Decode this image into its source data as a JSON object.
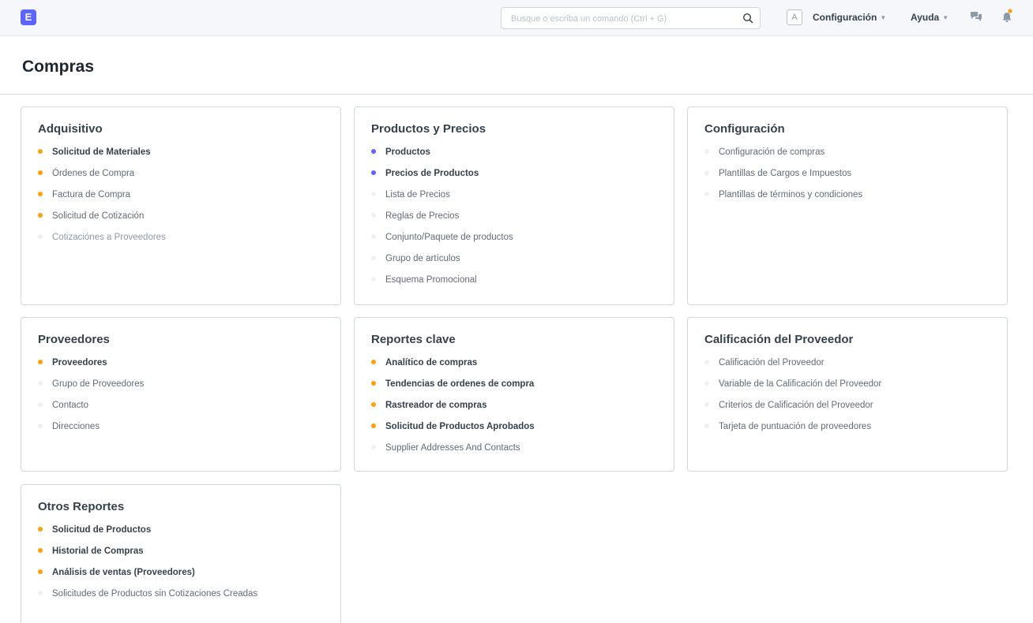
{
  "app": {
    "logo_letter": "E"
  },
  "navbar": {
    "search_placeholder": "Busque o escriba un comando (Ctrl + G)",
    "avatar_letter": "A",
    "settings_label": "Configuración",
    "help_label": "Ayuda",
    "accent_color": "#5e64ff",
    "notification_dot_color": "#ffa00a"
  },
  "page": {
    "title": "Compras"
  },
  "cards": {
    "adquisitivo": {
      "title": "Adquisitivo",
      "links": [
        {
          "label": "Solicitud de Materiales",
          "dot": "orange"
        },
        {
          "label": "Órdenes de Compra",
          "dot": "orange"
        },
        {
          "label": "Factura de Compra",
          "dot": "orange"
        },
        {
          "label": "Solicitud de Cotización",
          "dot": "orange"
        },
        {
          "label": "Cotizaciónes a Proveedores",
          "dot": "grey"
        }
      ]
    },
    "productos": {
      "title": "Productos y Precios",
      "links": [
        {
          "label": "Productos",
          "dot": "blue"
        },
        {
          "label": "Precios de Productos",
          "dot": "blue"
        },
        {
          "label": "Lista de Precios",
          "dot": "grey"
        },
        {
          "label": "Reglas de Precios",
          "dot": "grey"
        },
        {
          "label": "Conjunto/Paquete de productos",
          "dot": "grey"
        },
        {
          "label": "Grupo de artículos",
          "dot": "grey"
        },
        {
          "label": "Esquema Promocional",
          "dot": "grey"
        }
      ]
    },
    "configuracion": {
      "title": "Configuración",
      "links": [
        {
          "label": "Configuración de compras",
          "dot": "grey"
        },
        {
          "label": "Plantillas de Cargos e Impuestos",
          "dot": "grey"
        },
        {
          "label": "Plantillas de términos y condiciones",
          "dot": "grey"
        }
      ]
    },
    "proveedores": {
      "title": "Proveedores",
      "links": [
        {
          "label": "Proveedores",
          "dot": "orange"
        },
        {
          "label": "Grupo de Proveedores",
          "dot": "grey"
        },
        {
          "label": "Contacto",
          "dot": "grey"
        },
        {
          "label": "Direcciones",
          "dot": "grey"
        }
      ]
    },
    "reportes": {
      "title": "Reportes clave",
      "links": [
        {
          "label": "Analítico de compras",
          "dot": "orange"
        },
        {
          "label": "Tendencias de ordenes de compra",
          "dot": "orange"
        },
        {
          "label": "Rastreador de compras",
          "dot": "orange"
        },
        {
          "label": "Solicitud de Productos Aprobados",
          "dot": "orange"
        },
        {
          "label": "Supplier Addresses And Contacts",
          "dot": "grey"
        }
      ]
    },
    "calificacion": {
      "title": "Calificación del Proveedor",
      "links": [
        {
          "label": "Calificación del Proveedor",
          "dot": "grey"
        },
        {
          "label": "Variable de la Calificación del Proveedor",
          "dot": "grey"
        },
        {
          "label": "Criterios de Calificación del Proveedor",
          "dot": "grey"
        },
        {
          "label": "Tarjeta de puntuación de proveedores",
          "dot": "grey"
        }
      ]
    },
    "otros": {
      "title": "Otros Reportes",
      "links": [
        {
          "label": "Solicitud de Productos",
          "dot": "orange"
        },
        {
          "label": "Historial de Compras",
          "dot": "orange"
        },
        {
          "label": "Análisis de ventas (Proveedores)",
          "dot": "orange"
        },
        {
          "label": "Solicitudes de Productos sin Cotizaciones Creadas",
          "dot": "grey"
        }
      ]
    }
  }
}
